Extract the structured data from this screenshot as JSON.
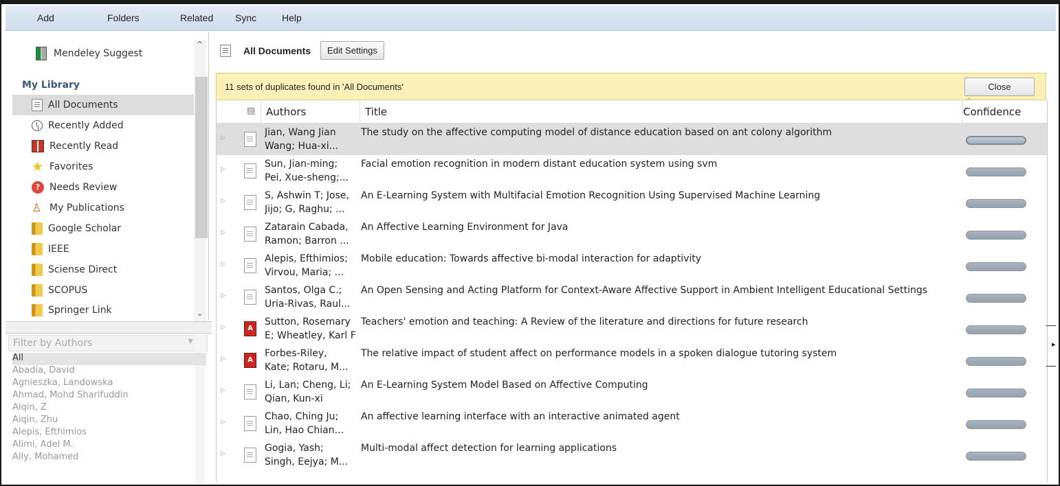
{
  "menu": [
    "Add",
    "Folders",
    "Related",
    "Sync",
    "Help"
  ],
  "sidebar": {
    "suggest_label": "Mendeley Suggest",
    "library_heading": "My Library",
    "items": [
      {
        "label": "All Documents",
        "icon": "documents-icon"
      },
      {
        "label": "Recently Added",
        "icon": "clock-icon"
      },
      {
        "label": "Recently Read",
        "icon": "book-open-icon"
      },
      {
        "label": "Favorites",
        "icon": "star-icon"
      },
      {
        "label": "Needs Review",
        "icon": "question-icon"
      },
      {
        "label": "My Publications",
        "icon": "person-icon"
      },
      {
        "label": "Google Scholar",
        "icon": "folder-icon"
      },
      {
        "label": "IEEE",
        "icon": "folder-icon"
      },
      {
        "label": "Sciense Direct",
        "icon": "folder-icon"
      },
      {
        "label": "SCOPUS",
        "icon": "folder-icon"
      },
      {
        "label": "Springer Link",
        "icon": "folder-icon"
      }
    ]
  },
  "filter": {
    "placeholder": "Filter by Authors",
    "authors": [
      "All",
      "Abadía, David",
      "Agnieszka, Landowska",
      "Ahmad, Mohd Sharifuddin",
      "Aiqin, Z",
      "Aiqin, Zhu",
      "Alepis, Efthimios",
      "Alimi, Adel M.",
      "Ally, Mohamed"
    ]
  },
  "main": {
    "title": "All Documents",
    "edit_settings": "Edit Settings",
    "notice": "11 sets of duplicates found in 'All Documents'",
    "close": "Close",
    "columns": {
      "authors": "Authors",
      "title": "Title",
      "confidence": "Confidence"
    },
    "rows": [
      {
        "authors1": "Jian, Wang Jian",
        "authors2": "Wang; Hua-xi...",
        "title": "The study on the affective computing model of distance education based on ant colony algorithm",
        "pdf": false
      },
      {
        "authors1": "Sun, Jian-ming;",
        "authors2": "Pei, Xue-sheng;...",
        "title": "Facial emotion recognition in modern distant education system using svm",
        "pdf": false
      },
      {
        "authors1": "S, Ashwin T; Jose,",
        "authors2": "Jijo; G, Raghu; ...",
        "title": "An E-Learning System with Multifacial Emotion Recognition Using Supervised Machine Learning",
        "pdf": false
      },
      {
        "authors1": "Zatarain Cabada,",
        "authors2": "Ramon; Barron ...",
        "title": "An Affective Learning Environment for Java",
        "pdf": false
      },
      {
        "authors1": "Alepis, Efthimios;",
        "authors2": "Virvou, Maria; ...",
        "title": "Mobile education: Towards affective bi-modal interaction for adaptivity",
        "pdf": false
      },
      {
        "authors1": "Santos, Olga C.;",
        "authors2": "Uria-Rivas, Raul...",
        "title": "An Open Sensing and Acting Platform for Context-Aware Affective Support in Ambient Intelligent Educational Settings",
        "pdf": false
      },
      {
        "authors1": "Sutton, Rosemary",
        "authors2": "E; Wheatley, Karl F",
        "title": "Teachers' emotion and teaching: A Review of the literature and directions for future research",
        "pdf": true
      },
      {
        "authors1": "Forbes-Riley,",
        "authors2": "Kate; Rotaru, M...",
        "title": "The relative impact of student affect on performance models in a spoken dialogue tutoring system",
        "pdf": true
      },
      {
        "authors1": "Li, Lan; Cheng, Li;",
        "authors2": "Qian, Kun-xi",
        "title": "An E-Learning System Model Based on Affective Computing",
        "pdf": false
      },
      {
        "authors1": "Chao, Ching Ju;",
        "authors2": "Lin, Hao Chian...",
        "title": "An affective learning interface with an interactive animated agent",
        "pdf": false
      },
      {
        "authors1": "Gogia, Yash;",
        "authors2": "Singh, Eejya; M...",
        "title": "Multi-modal affect detection for learning applications",
        "pdf": false
      }
    ]
  }
}
